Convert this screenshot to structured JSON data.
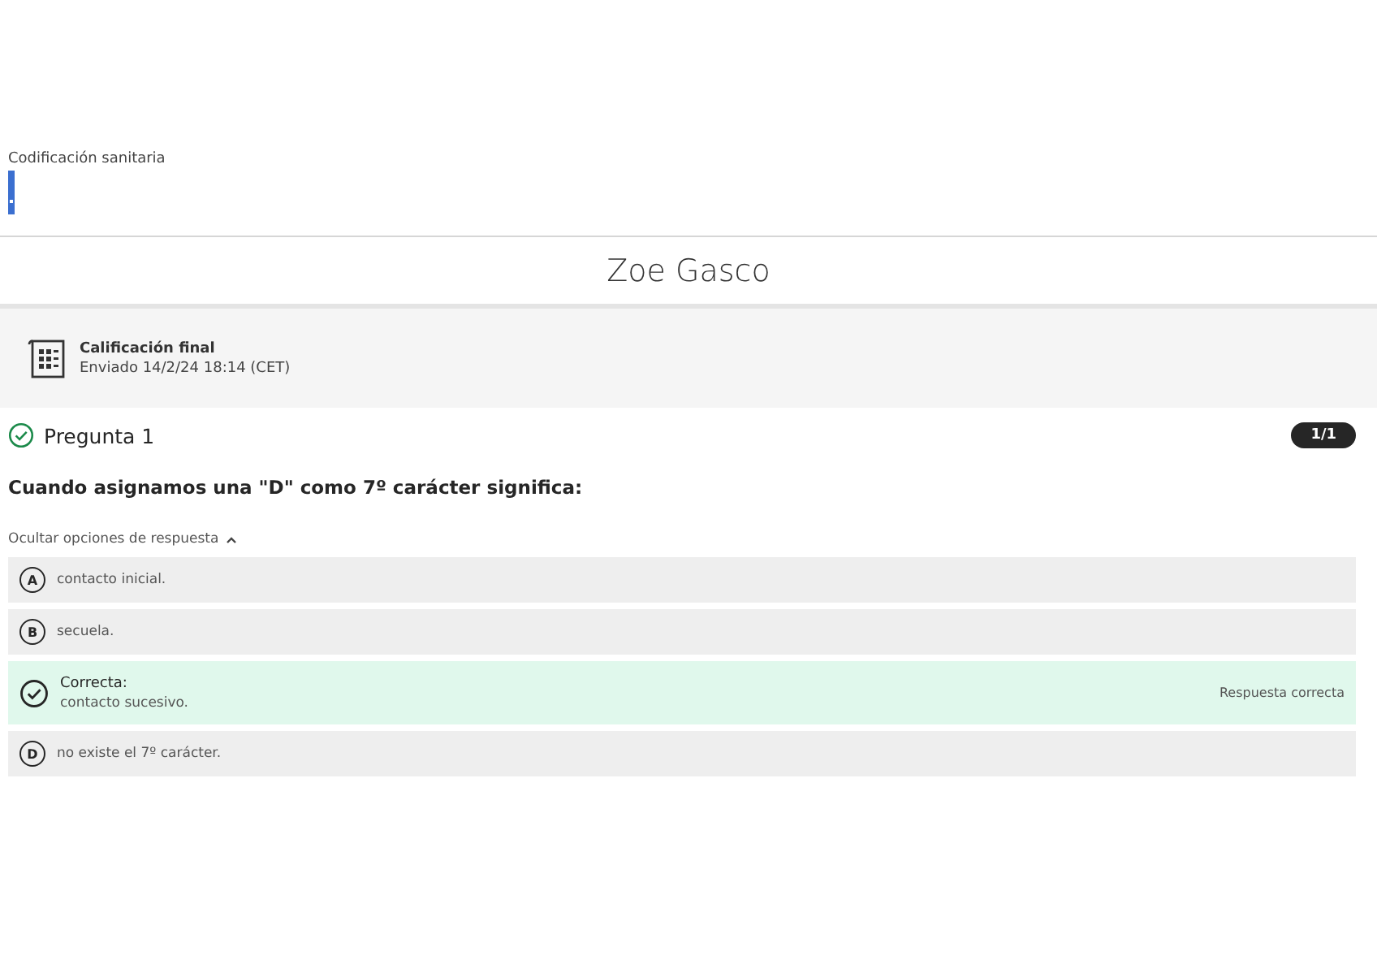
{
  "course": {
    "title": "Codificación sanitaria"
  },
  "student": {
    "name": "Zoe Gasco"
  },
  "grade": {
    "title": "Calificación final",
    "submitted": "Enviado 14/2/24 18:14 (CET)"
  },
  "question": {
    "title": "Pregunta 1",
    "correct": true,
    "score": "1/1",
    "text": "Cuando asignamos una \"D\" como 7º carácter significa:"
  },
  "options_toggle": {
    "label": "Ocultar opciones de respuesta",
    "expanded": true
  },
  "options": [
    {
      "kind": "letter",
      "letter": "A",
      "text": "contacto inicial."
    },
    {
      "kind": "letter",
      "letter": "B",
      "text": "secuela."
    },
    {
      "kind": "correct",
      "label": "Correcta:",
      "text": "contacto sucesivo.",
      "feedback": "Respuesta correcta"
    },
    {
      "kind": "letter",
      "letter": "D",
      "text": "no existe el 7º carácter."
    }
  ]
}
